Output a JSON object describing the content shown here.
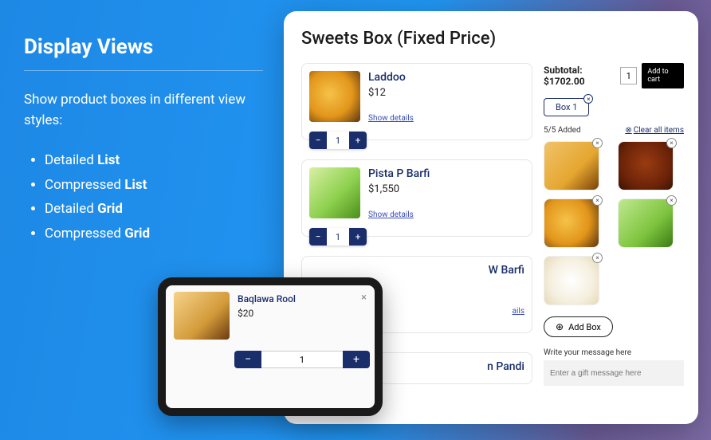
{
  "left": {
    "title": "Display Views",
    "intro": "Show product boxes in different view styles:",
    "items": [
      {
        "pre": "Detailed ",
        "bold": "List"
      },
      {
        "pre": "Compressed ",
        "bold": "List"
      },
      {
        "pre": "Detailed ",
        "bold": "Grid"
      },
      {
        "pre": "Compressed ",
        "bold": "Grid"
      }
    ]
  },
  "main": {
    "title": "Sweets Box (Fixed Price)",
    "products": [
      {
        "name": "Laddoo",
        "price": "$12",
        "details": "Show details",
        "qty": "1",
        "img": "sw-laddoo"
      },
      {
        "name": "Pista P Barfi",
        "price": "$1,550",
        "details": "Show details",
        "qty": "1",
        "img": "sw-pista"
      },
      {
        "name_partial": "W Barfi",
        "details_partial": "ails",
        "img": "sw-barfi"
      },
      {
        "name_partial": "n Pandi"
      }
    ],
    "sidebar": {
      "subtotal_label": "Subtotal: $1702.00",
      "qty": "1",
      "add_cart": "Add to cart",
      "box_pill": "Box 1",
      "added": "5/5 Added",
      "clear": "Clear all items",
      "minis": [
        "sw-roll",
        "sw-gulab",
        "sw-laddoo",
        "sw-pista2",
        "sw-white"
      ],
      "add_box": "Add Box",
      "msg_label": "Write your message here",
      "msg_placeholder": "Enter a gift message here"
    }
  },
  "tablet": {
    "cut_text": "",
    "title": "Baqlawa Rool",
    "price": "$20",
    "qty": "1",
    "img": "sw-baqlawa"
  }
}
